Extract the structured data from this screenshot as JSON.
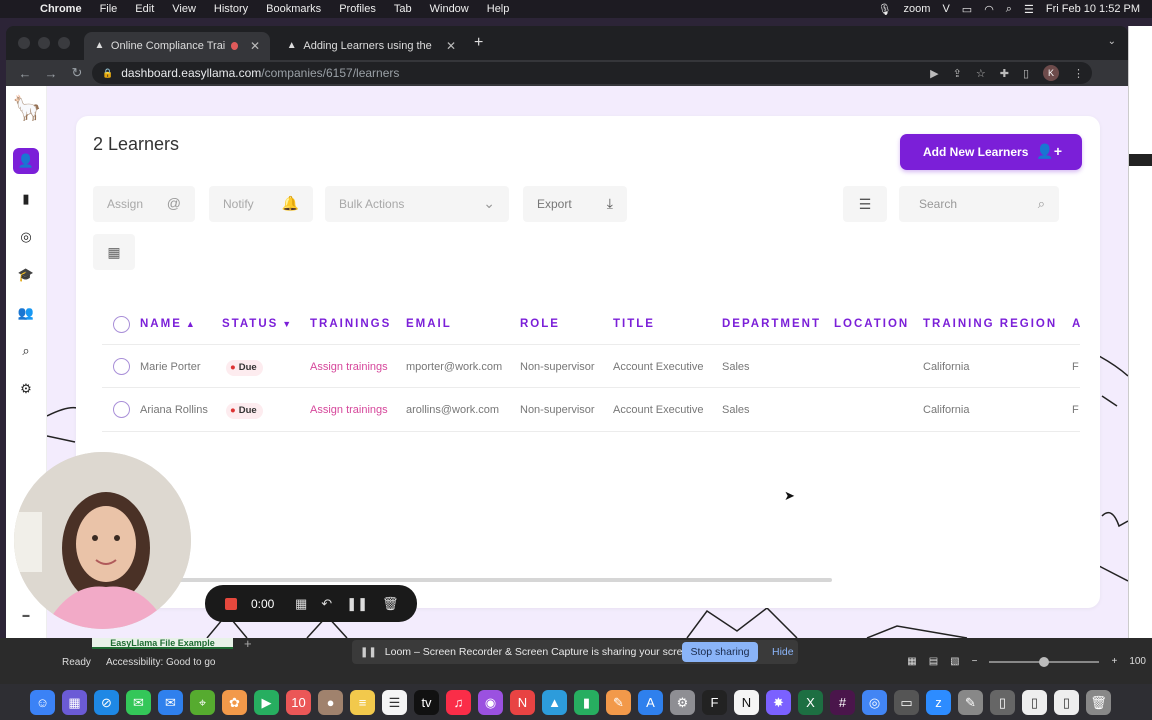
{
  "menubar": {
    "app": "Chrome",
    "items": [
      "File",
      "Edit",
      "View",
      "History",
      "Bookmarks",
      "Profiles",
      "Tab",
      "Window",
      "Help"
    ],
    "zoom_label": "zoom",
    "clock": "Fri Feb 10  1:52 PM"
  },
  "browser": {
    "tabs": [
      {
        "title": "Online Compliance Training"
      },
      {
        "title": "Adding Learners using the File"
      }
    ],
    "url_host": "dashboard.easyllama.com",
    "url_path": "/companies/6157/learners",
    "profile_initial": "K"
  },
  "page": {
    "title": "2 Learners",
    "add_button": "Add New Learners",
    "controls": {
      "assign": "Assign",
      "notify": "Notify",
      "bulk_actions": "Bulk Actions",
      "export": "Export",
      "search_placeholder": "Search"
    },
    "columns": [
      "NAME",
      "STATUS",
      "TRAININGS",
      "EMAIL",
      "ROLE",
      "TITLE",
      "DEPARTMENT",
      "LOCATION",
      "TRAINING REGION",
      "A"
    ],
    "rows": [
      {
        "name": "Marie Porter",
        "status": "Due",
        "trainings": "Assign trainings",
        "email": "mporter@work.com",
        "role": "Non-supervisor",
        "title": "Account Executive",
        "department": "Sales",
        "location": "",
        "region": "California",
        "extra": "F"
      },
      {
        "name": "Ariana Rollins",
        "status": "Due",
        "trainings": "Assign trainings",
        "email": "arollins@work.com",
        "role": "Non-supervisor",
        "title": "Account Executive",
        "department": "Sales",
        "location": "",
        "region": "California",
        "extra": "F"
      }
    ]
  },
  "loom": {
    "timer": "0:00",
    "share_message": "Loom – Screen Recorder & Screen Capture is sharing your screen.",
    "stop_sharing": "Stop sharing",
    "hide": "Hide"
  },
  "excel": {
    "sheet_tab": "EasyLlama File Example",
    "status_ready": "Ready",
    "accessibility": "Accessibility: Good to go",
    "zoom": "100"
  },
  "colors": {
    "accent": "#7b1fd8",
    "link": "#d6479b",
    "page_bg": "#f3ecfd"
  }
}
